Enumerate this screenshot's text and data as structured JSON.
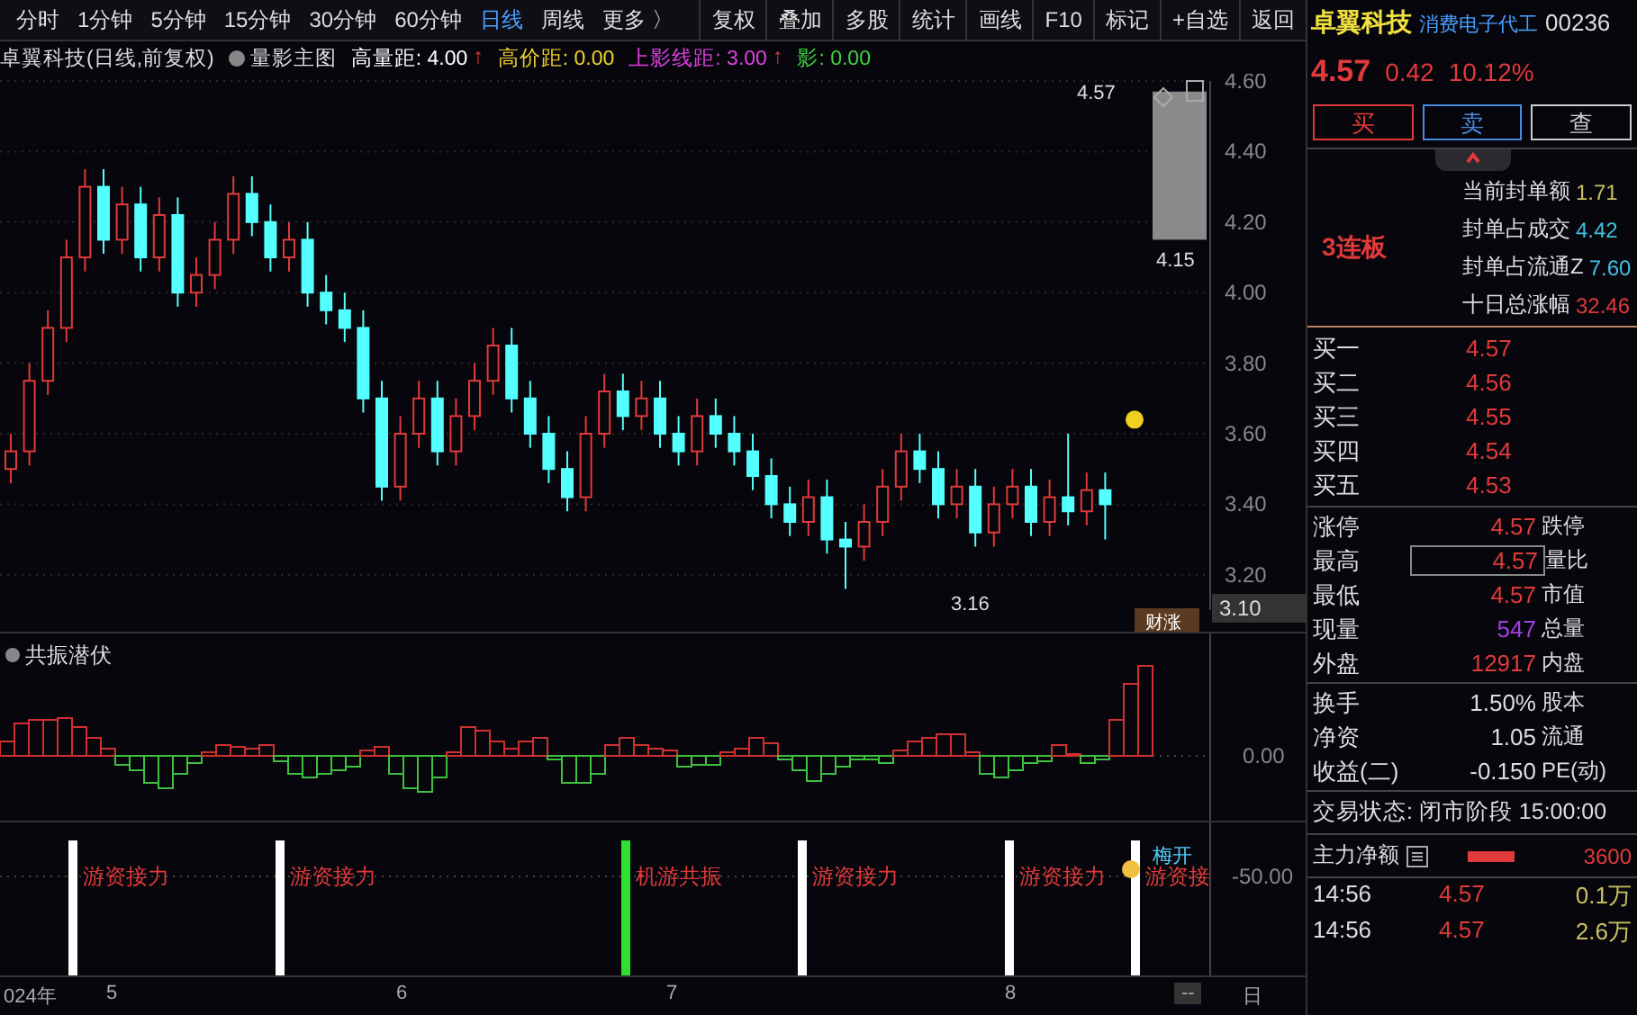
{
  "toolbar": {
    "periods": [
      {
        "label": "分时",
        "selected": false
      },
      {
        "label": "1分钟",
        "selected": false
      },
      {
        "label": "5分钟",
        "selected": false
      },
      {
        "label": "15分钟",
        "selected": false
      },
      {
        "label": "30分钟",
        "selected": false
      },
      {
        "label": "60分钟",
        "selected": false
      },
      {
        "label": "日线",
        "selected": true
      },
      {
        "label": "周线",
        "selected": false
      },
      {
        "label": "更多 〉",
        "selected": false
      }
    ],
    "tools": [
      "复权",
      "叠加",
      "多股",
      "统计",
      "画线",
      "F10",
      "标记",
      "+自选",
      "返回"
    ]
  },
  "chart_header": {
    "title": "卓翼科技(日线,前复权)",
    "indicator": "量影主图",
    "params": [
      {
        "text": "高量距: 4.00",
        "arrow": "↑",
        "color": "#ffffff"
      },
      {
        "text": "高价距: 0.00",
        "color": "#f0d030"
      },
      {
        "text": "上影线距: 3.00",
        "arrow": "↑",
        "color": "#e040e0"
      },
      {
        "text": "影: 0.00",
        "color": "#40d040"
      }
    ]
  },
  "main_chart": {
    "chart_data": {
      "type": "candlestick",
      "ylim": [
        3.1,
        4.6
      ],
      "grid": true,
      "yticks": [
        {
          "value": 4.6,
          "label": "4.60"
        },
        {
          "value": 4.4,
          "label": "4.40"
        },
        {
          "value": 4.2,
          "label": "4.20"
        },
        {
          "value": 4.0,
          "label": "4.00"
        },
        {
          "value": 3.8,
          "label": "3.80"
        },
        {
          "value": 3.6,
          "label": "3.60"
        },
        {
          "value": 3.4,
          "label": "3.40"
        },
        {
          "value": 3.2,
          "label": "3.20"
        }
      ],
      "categories": [
        null,
        null,
        null,
        null,
        null,
        null,
        null,
        null,
        null,
        null,
        null,
        null,
        null,
        null,
        null,
        null,
        null,
        null,
        null,
        null,
        null,
        null,
        null,
        null,
        null,
        null,
        null,
        null,
        null,
        null,
        null,
        null,
        null,
        null,
        null,
        null,
        null,
        null,
        null,
        null,
        null,
        null,
        null,
        null,
        null,
        null,
        null,
        null,
        null,
        null,
        null,
        null,
        null,
        null,
        null,
        null,
        null,
        null,
        null,
        null
      ],
      "ohlc": [
        [
          3.5,
          3.6,
          3.46,
          3.55
        ],
        [
          3.55,
          3.8,
          3.51,
          3.75
        ],
        [
          3.75,
          3.95,
          3.71,
          3.9
        ],
        [
          3.9,
          4.15,
          3.86,
          4.1
        ],
        [
          4.1,
          4.35,
          4.06,
          4.3
        ],
        [
          4.3,
          4.35,
          4.11,
          4.15
        ],
        [
          4.15,
          4.3,
          4.11,
          4.25
        ],
        [
          4.25,
          4.3,
          4.06,
          4.1
        ],
        [
          4.1,
          4.27,
          4.06,
          4.22
        ],
        [
          4.22,
          4.27,
          3.96,
          4.0
        ],
        [
          4.0,
          4.1,
          3.96,
          4.05
        ],
        [
          4.05,
          4.2,
          4.01,
          4.15
        ],
        [
          4.15,
          4.33,
          4.11,
          4.28
        ],
        [
          4.28,
          4.33,
          4.16,
          4.2
        ],
        [
          4.2,
          4.25,
          4.06,
          4.1
        ],
        [
          4.1,
          4.2,
          4.06,
          4.15
        ],
        [
          4.15,
          4.2,
          3.96,
          4.0
        ],
        [
          4.0,
          4.05,
          3.91,
          3.95
        ],
        [
          3.95,
          4.0,
          3.86,
          3.9
        ],
        [
          3.9,
          3.95,
          3.66,
          3.7
        ],
        [
          3.7,
          3.75,
          3.41,
          3.45
        ],
        [
          3.45,
          3.65,
          3.41,
          3.6
        ],
        [
          3.6,
          3.75,
          3.56,
          3.7
        ],
        [
          3.7,
          3.75,
          3.51,
          3.55
        ],
        [
          3.55,
          3.7,
          3.51,
          3.65
        ],
        [
          3.65,
          3.8,
          3.61,
          3.75
        ],
        [
          3.75,
          3.9,
          3.71,
          3.85
        ],
        [
          3.85,
          3.9,
          3.66,
          3.7
        ],
        [
          3.7,
          3.75,
          3.56,
          3.6
        ],
        [
          3.6,
          3.65,
          3.46,
          3.5
        ],
        [
          3.5,
          3.55,
          3.38,
          3.42
        ],
        [
          3.42,
          3.65,
          3.38,
          3.6
        ],
        [
          3.6,
          3.77,
          3.56,
          3.72
        ],
        [
          3.72,
          3.77,
          3.61,
          3.65
        ],
        [
          3.65,
          3.75,
          3.61,
          3.7
        ],
        [
          3.7,
          3.75,
          3.56,
          3.6
        ],
        [
          3.6,
          3.65,
          3.51,
          3.55
        ],
        [
          3.55,
          3.7,
          3.51,
          3.65
        ],
        [
          3.65,
          3.7,
          3.56,
          3.6
        ],
        [
          3.6,
          3.65,
          3.51,
          3.55
        ],
        [
          3.55,
          3.6,
          3.44,
          3.48
        ],
        [
          3.48,
          3.53,
          3.36,
          3.4
        ],
        [
          3.4,
          3.45,
          3.31,
          3.35
        ],
        [
          3.35,
          3.47,
          3.31,
          3.42
        ],
        [
          3.42,
          3.47,
          3.26,
          3.3
        ],
        [
          3.3,
          3.35,
          3.16,
          3.28
        ],
        [
          3.28,
          3.4,
          3.24,
          3.35
        ],
        [
          3.35,
          3.5,
          3.31,
          3.45
        ],
        [
          3.45,
          3.6,
          3.41,
          3.55
        ],
        [
          3.55,
          3.6,
          3.46,
          3.5
        ],
        [
          3.5,
          3.55,
          3.36,
          3.4
        ],
        [
          3.4,
          3.5,
          3.36,
          3.45
        ],
        [
          3.45,
          3.5,
          3.28,
          3.32
        ],
        [
          3.32,
          3.45,
          3.28,
          3.4
        ],
        [
          3.4,
          3.5,
          3.36,
          3.45
        ],
        [
          3.45,
          3.5,
          3.31,
          3.35
        ],
        [
          3.35,
          3.47,
          3.31,
          3.42
        ],
        [
          3.42,
          3.6,
          3.34,
          3.38
        ],
        [
          3.38,
          3.49,
          3.34,
          3.44
        ],
        [
          3.44,
          3.49,
          3.3,
          3.4
        ]
      ]
    },
    "high_label": "4.57",
    "mid_label": "4.15",
    "low_label": "3.16",
    "current_label": "3.10",
    "badge": "财涨"
  },
  "indicator_chart": {
    "title": "共振潜伏",
    "ytick": "0.00"
  },
  "signal_chart": {
    "ytick": "-50.00",
    "signals": [
      {
        "label": "游资接力",
        "color": "#ffffff"
      },
      {
        "label": "游资接力",
        "color": "#ffffff"
      },
      {
        "label": "机游共振",
        "color": "#30e030"
      },
      {
        "label": "游资接力",
        "color": "#ffffff"
      },
      {
        "label": "游资接力",
        "color": "#ffffff"
      },
      {
        "label": "游资接",
        "color": "#ffffff"
      }
    ],
    "note": "梅开"
  },
  "time_axis": {
    "labels": [
      "024年",
      "5",
      "6",
      "7",
      "8"
    ],
    "end": "--",
    "period": "日"
  },
  "quote": {
    "name": "卓翼科技",
    "sector": "消费电子代工",
    "code": "00236",
    "price": "4.57",
    "change": "0.42",
    "percent": "10.12%",
    "actions": [
      {
        "label": "买",
        "color": "#e03a3a"
      },
      {
        "label": "卖",
        "color": "#4a8ae0"
      },
      {
        "label": "查",
        "color": "#cccccc"
      }
    ],
    "streak": "3连板",
    "seal": [
      {
        "label": "当前封单额",
        "value": "1.71",
        "color": "#c8c060"
      },
      {
        "label": "封单占成交",
        "value": "4.42",
        "color": "#40c0e0"
      },
      {
        "label": "封单占流通Z",
        "value": "7.60",
        "color": "#40c0e0"
      },
      {
        "label": "十日总涨幅",
        "value": "32.46",
        "color": "#e03a3a"
      }
    ],
    "bids": [
      {
        "label": "买一",
        "price": "4.57"
      },
      {
        "label": "买二",
        "price": "4.56"
      },
      {
        "label": "买三",
        "price": "4.55"
      },
      {
        "label": "买四",
        "price": "4.54"
      },
      {
        "label": "买五",
        "price": "4.53"
      }
    ],
    "stats": [
      {
        "label": "涨停",
        "value": "4.57",
        "label2": "跌停",
        "color": "#e03a3a"
      },
      {
        "label": "最高",
        "value": "4.57",
        "label2": "量比",
        "color": "#e03a3a",
        "boxed": true
      },
      {
        "label": "最低",
        "value": "4.57",
        "label2": "市值",
        "color": "#e03a3a"
      },
      {
        "label": "现量",
        "value": "547",
        "label2": "总量",
        "color": "#a040e0"
      },
      {
        "label": "外盘",
        "value": "12917",
        "label2": "内盘",
        "color": "#e03a3a"
      }
    ],
    "stats2": [
      {
        "label": "换手",
        "value": "1.50%",
        "label2": "股本"
      },
      {
        "label": "净资",
        "value": "1.05",
        "label2": "流通"
      },
      {
        "label": "收益(二)",
        "value": "-0.150",
        "label2": "PE(动)"
      }
    ],
    "status": "交易状态: 闭市阶段 15:00:00",
    "flow_label": "主力净额",
    "flow_value": "3600",
    "ticks": [
      {
        "time": "14:56",
        "price": "4.57",
        "volume": "0.1万"
      },
      {
        "time": "14:56",
        "price": "4.57",
        "volume": "2.6万"
      }
    ]
  }
}
